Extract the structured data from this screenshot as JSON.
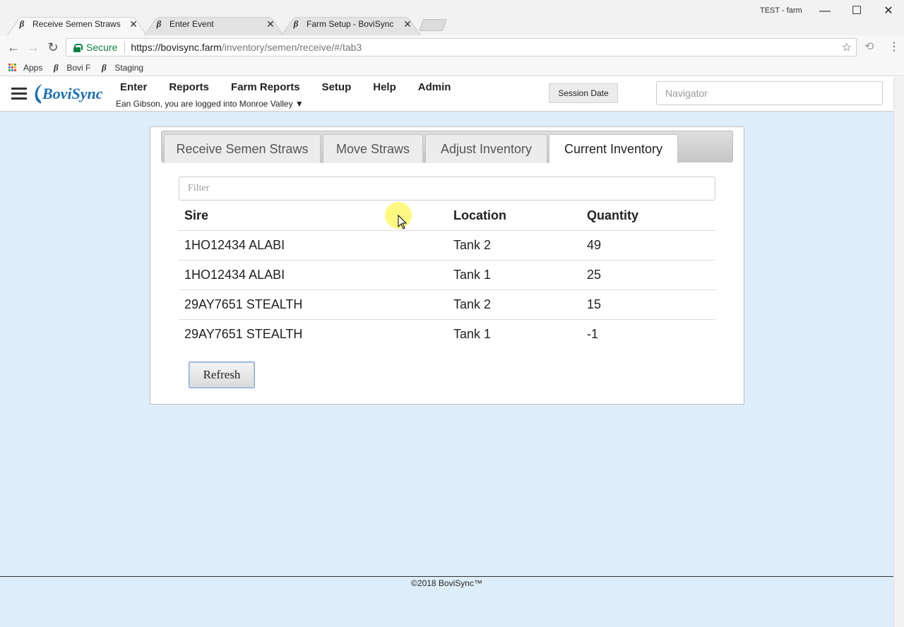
{
  "browser": {
    "tabs": [
      {
        "label": "Receive Semen Straws",
        "active": true
      },
      {
        "label": "Enter Event",
        "active": false
      },
      {
        "label": "Farm Setup - BoviSync",
        "active": false
      }
    ],
    "profile_label": "TEST - farm",
    "window_controls": {
      "minimize": "—",
      "maximize": "☐",
      "close": "✕"
    },
    "secure_label": "Secure",
    "url_host": "https://bovisync.farm",
    "url_path": "/inventory/semen/receive/#/tab3",
    "bookmarks": [
      "Apps",
      "Bovi F",
      "Staging"
    ],
    "icons": {
      "back": "back-arrow-icon",
      "forward": "forward-arrow-icon",
      "reload": "reload-icon",
      "star": "bookmark-star-icon",
      "extension": "extension-icon",
      "menu": "more-vert-icon"
    }
  },
  "app": {
    "logo_text": "BoviSync",
    "menu": [
      "Enter",
      "Reports",
      "Farm Reports",
      "Setup",
      "Help",
      "Admin"
    ],
    "user_line": "Ean Gibson, you are logged into Monroe Valley ▼",
    "session_date_label": "Session Date",
    "navigator_placeholder": "Navigator"
  },
  "inventory": {
    "tabs": [
      "Receive Semen Straws",
      "Move Straws",
      "Adjust Inventory",
      "Current Inventory"
    ],
    "active_tab": "Current Inventory",
    "filter_placeholder": "Filter",
    "columns": [
      "Sire",
      "Location",
      "Quantity"
    ],
    "rows": [
      {
        "sire": "1HO12434 ALABI",
        "location": "Tank 2",
        "quantity": "49"
      },
      {
        "sire": "1HO12434 ALABI",
        "location": "Tank 1",
        "quantity": "25"
      },
      {
        "sire": "29AY7651 STEALTH",
        "location": "Tank 2",
        "quantity": "15"
      },
      {
        "sire": "29AY7651 STEALTH",
        "location": "Tank 1",
        "quantity": "-1"
      }
    ],
    "refresh_label": "Refresh"
  },
  "footer": {
    "text": "©2018 BoviSync™"
  },
  "colors": {
    "page_bg": "#deedfa",
    "secure_green": "#0b8043",
    "panel_border": "#bfbfbf"
  }
}
